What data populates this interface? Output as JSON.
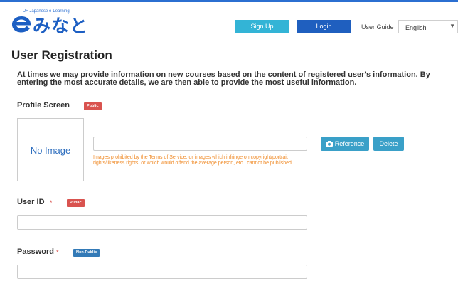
{
  "header": {
    "logo_tagline": "JF Japanese e-Learning",
    "logo_text": "みなと",
    "signup_label": "Sign Up",
    "login_label": "Login",
    "user_guide_label": "User Guide",
    "language_selected": "English",
    "colors": {
      "accent": "#1f5fbf",
      "signup": "#33b4d6"
    }
  },
  "page": {
    "title": "User Registration",
    "intro": "At times we may provide information on new courses based on the content of registered user's information. By entering the most accurate details, we are then able to provide the most useful information."
  },
  "profile": {
    "label": "Profile Screen",
    "badge": "Public",
    "no_image": "No Image",
    "input_value": "",
    "warning": "Images prohibited by the Terms of Service, or images which infringe on copyright/portrait rights/likeness rights, or which would offend the average person, etc., cannot be published.",
    "reference_label": "Reference",
    "delete_label": "Delete",
    "icons": {
      "reference": "camera-icon"
    }
  },
  "user_id": {
    "label": "User ID",
    "required_mark": "*",
    "badge": "Public",
    "value": ""
  },
  "password": {
    "label": "Password",
    "required_mark": "*",
    "badge": "Non-Public",
    "value": ""
  }
}
